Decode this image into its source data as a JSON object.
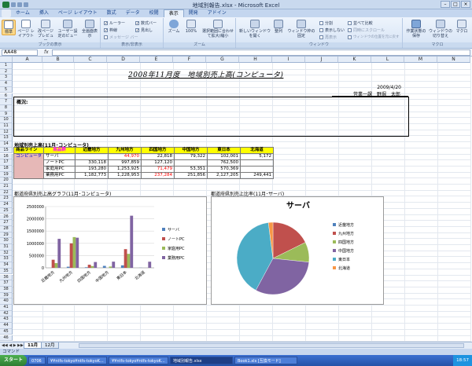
{
  "window": {
    "title": "地域別報告.xlsx - Microsoft Excel"
  },
  "ribbon_tabs": [
    "ホーム",
    "挿入",
    "ページ レイアウト",
    "数式",
    "データ",
    "校閲",
    "表示",
    "開発",
    "アドイン"
  ],
  "ribbon": {
    "groups": [
      "ブックの表示",
      "表示/非表示",
      "ズーム",
      "ウィンドウ",
      "マクロ"
    ],
    "buttons": {
      "normal": "標準",
      "page_layout": "ページ レイアウト",
      "page_break": "改ページ プレビュー",
      "custom_view": "ユーザー設定のビュー",
      "full_screen": "全画面表示",
      "zoom": "ズーム",
      "zoom100": "100%",
      "zoom_selection": "選択範囲に合わせて拡大/縮小",
      "new_window": "新しいウィンドウを開く",
      "arrange_all": "整列",
      "freeze_panes": "ウィンドウ枠の固定",
      "split": "分割",
      "hide": "表示しない",
      "unhide": "再表示",
      "side_by_side": "並べて比較",
      "sync_scroll": "同時にスクロール",
      "reset_position": "ウィンドウの位置を元に戻す",
      "save_workspace": "作業状態の保存",
      "switch_windows": "ウィンドウの切り替え",
      "macro": "マクロ"
    },
    "checks": {
      "ruler": "ルーラー",
      "gridlines": "枠線",
      "message_bar": "メッセージ バー",
      "formula_bar": "数式バー",
      "headings": "見出し"
    }
  },
  "formula_bar": {
    "name_box": "AA48",
    "fx": "fx",
    "value": ""
  },
  "columns": [
    "A",
    "B",
    "C",
    "D",
    "E",
    "F",
    "G",
    "H",
    "I",
    "J",
    "K",
    "L",
    "M",
    "N"
  ],
  "rows": [
    "1",
    "2",
    "3",
    "4",
    "5",
    "6",
    "7",
    "8",
    "9",
    "10",
    "11",
    "12",
    "13",
    "14",
    "15",
    "16",
    "17",
    "18",
    "19",
    "20",
    "21",
    "22",
    "23",
    "24",
    "25",
    "26",
    "27",
    "28",
    "29",
    "30",
    "31",
    "32",
    "33",
    "34",
    "35",
    "36",
    "37",
    "38",
    "39",
    "40",
    "41",
    "42",
    "43",
    "44",
    "45",
    "46"
  ],
  "sheet": {
    "title": "2008年11月度　地域別売上高(コンピュータ)",
    "date": "2009/4/20",
    "author": "営業一課　野堀　太郎",
    "summary_label": "概況:",
    "table_title": "地域別売上高(11月･コンピュータ)",
    "table": {
      "headers": [
        "商品ライン",
        "商品群",
        "近畿地方",
        "九州地方",
        "四国地方",
        "中国地方",
        "東日本",
        "北海道"
      ],
      "category": "コンピュータ",
      "rows": [
        {
          "item": "サーバ",
          "values": [
            "",
            "44,970",
            "22,818",
            "79,322",
            "102,001",
            "5,172"
          ],
          "red": [
            false,
            true,
            false,
            false,
            false,
            false
          ]
        },
        {
          "item": "ノートPC",
          "values": [
            "330,118",
            "997,859",
            "127,120",
            "",
            "762,500",
            ""
          ],
          "red": [
            false,
            false,
            false,
            false,
            false,
            false
          ]
        },
        {
          "item": "家庭用PC",
          "values": [
            "193,280",
            "1,253,925",
            "71,479",
            "53,351",
            "570,369",
            ""
          ],
          "red": [
            false,
            false,
            true,
            false,
            false,
            false
          ]
        },
        {
          "item": "業務用PC",
          "values": [
            "1,182,773",
            "1,228,953",
            "237,284",
            "251,856",
            "2,127,205",
            "249,441"
          ],
          "red": [
            false,
            false,
            true,
            false,
            false,
            false
          ]
        }
      ]
    },
    "bar_caption": "都道府県別売上高グラフ(11月･コンピュータ)",
    "pie_caption": "都道府県別売上比率(11月･サーバ)"
  },
  "chart_data": [
    {
      "type": "bar",
      "categories": [
        "近畿地方",
        "九州地方",
        "四国地方",
        "中国地方",
        "東日本",
        "北海道"
      ],
      "series": [
        {
          "name": "サーバ",
          "values": [
            0,
            44970,
            22818,
            79322,
            102001,
            5172
          ],
          "color": "#4f81bd"
        },
        {
          "name": "ノートPC",
          "values": [
            330118,
            997859,
            127120,
            0,
            762500,
            0
          ],
          "color": "#c0504d"
        },
        {
          "name": "家庭用PC",
          "values": [
            193280,
            1253925,
            71479,
            53351,
            570369,
            0
          ],
          "color": "#9bbb59"
        },
        {
          "name": "業務用PC",
          "values": [
            1182773,
            1228953,
            237284,
            251856,
            2127205,
            249441
          ],
          "color": "#8064a2"
        }
      ],
      "ylim": [
        0,
        2500000
      ],
      "yticks": [
        "2500000",
        "2000000",
        "1500000",
        "1000000",
        "500000",
        "0"
      ],
      "ytick_values": [
        2500000,
        2000000,
        1500000,
        1000000,
        500000,
        0
      ],
      "legend": "right"
    },
    {
      "type": "pie",
      "title": "サーバ",
      "labels": [
        "近畿地方",
        "九州地方",
        "四国地方",
        "中国地方",
        "東日本",
        "北海道"
      ],
      "values": [
        0,
        44970,
        22818,
        79322,
        102001,
        5172
      ],
      "colors": [
        "#4f81bd",
        "#c0504d",
        "#9bbb59",
        "#8064a2",
        "#4bacc6",
        "#f79646"
      ],
      "legend": "right"
    }
  ],
  "sheet_tabs": [
    "11月",
    "12月"
  ],
  "status": {
    "mode": "コマンド"
  },
  "taskbar": {
    "start": "スタート",
    "buttons": [
      "0706",
      "¥¥ntfs-tokyo¥ntfs-tokyoK...",
      "¥¥ntfs-tokyo¥ntfs-tokyoK...",
      "地域別報告.xlsx",
      "Book1.xls [互換モード]"
    ],
    "clock": "18:57"
  }
}
